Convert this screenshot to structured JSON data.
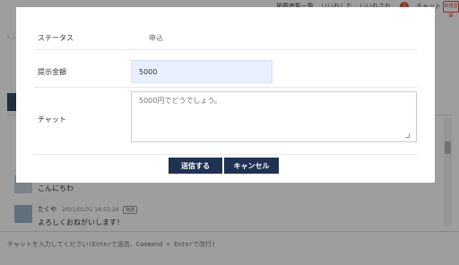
{
  "background": {
    "topnav": {
      "items": [
        "掲載者覧一覧",
        "いいねした",
        "いいねされ",
        "チャット"
      ],
      "badge_count": "1",
      "right_button": "新規登録"
    },
    "breadcrumb": "› ...",
    "messages": [
      {
        "text": "こんにちわ"
      },
      {
        "sender": "たくや",
        "timestamp": "2021/01/31 16:53:24",
        "read_badge": "既読",
        "text": "よろしくおねがいします！"
      }
    ],
    "chat_input": {
      "placeholder": "チャットを入力してください(Enterで送信、Command + Enterで改行)"
    }
  },
  "modal": {
    "status": {
      "label": "ステータス",
      "value": "申込"
    },
    "amount": {
      "label": "提示金額",
      "value": "5000"
    },
    "chat": {
      "label": "チャット",
      "placeholder": "5000円でどうでしょう。"
    },
    "buttons": {
      "send": "送信する",
      "cancel": "キャンセル"
    }
  },
  "colors": {
    "button_bg": "#1f3252",
    "amount_field_bg": "#e8f0fe",
    "badge": "#e74c3c"
  }
}
